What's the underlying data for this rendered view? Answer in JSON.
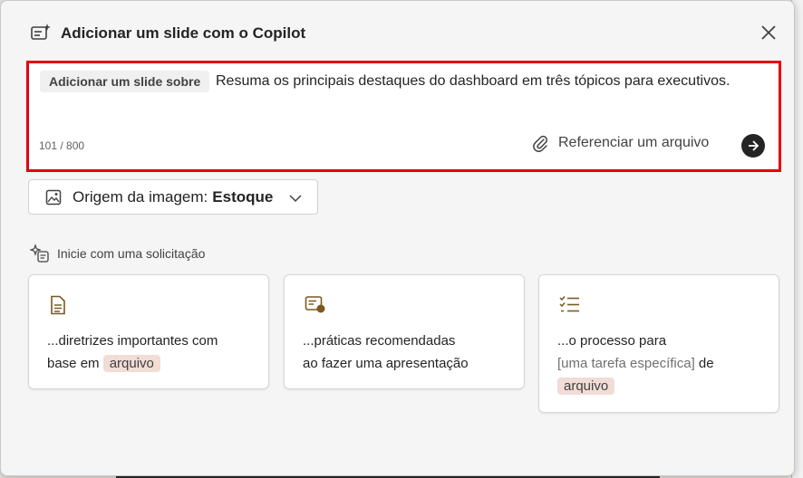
{
  "dialog": {
    "title": "Adicionar um slide com o Copilot",
    "close_label": "×"
  },
  "prompt": {
    "prefix_chip": "Adicionar um slide sobre",
    "text": "Resuma os principais destaques do dashboard em três tópicos para executivos.",
    "counter": "101 / 800",
    "reference_file_label": "Referenciar um arquivo",
    "highlight_color": "#e3000f"
  },
  "image_source": {
    "label": "Origem da imagem:",
    "value": "Estoque"
  },
  "suggestions": {
    "heading": "Inicie com uma solicitação",
    "cards": [
      {
        "line1": "...diretrizes importantes com",
        "line2_prefix": "base em ",
        "tag": "arquivo",
        "icon": "document-icon"
      },
      {
        "line1": "...práticas recomendadas",
        "line2": "ao fazer uma apresentação",
        "icon": "presenter-icon"
      },
      {
        "line1": "...o processo para",
        "placeholder": "[uma tarefa específica]",
        "connector": " de",
        "tag": "arquivo",
        "icon": "checklist-icon"
      }
    ]
  },
  "colors": {
    "accent_icon": "#7a5a1e",
    "tag_bg": "#f1dcd6"
  }
}
